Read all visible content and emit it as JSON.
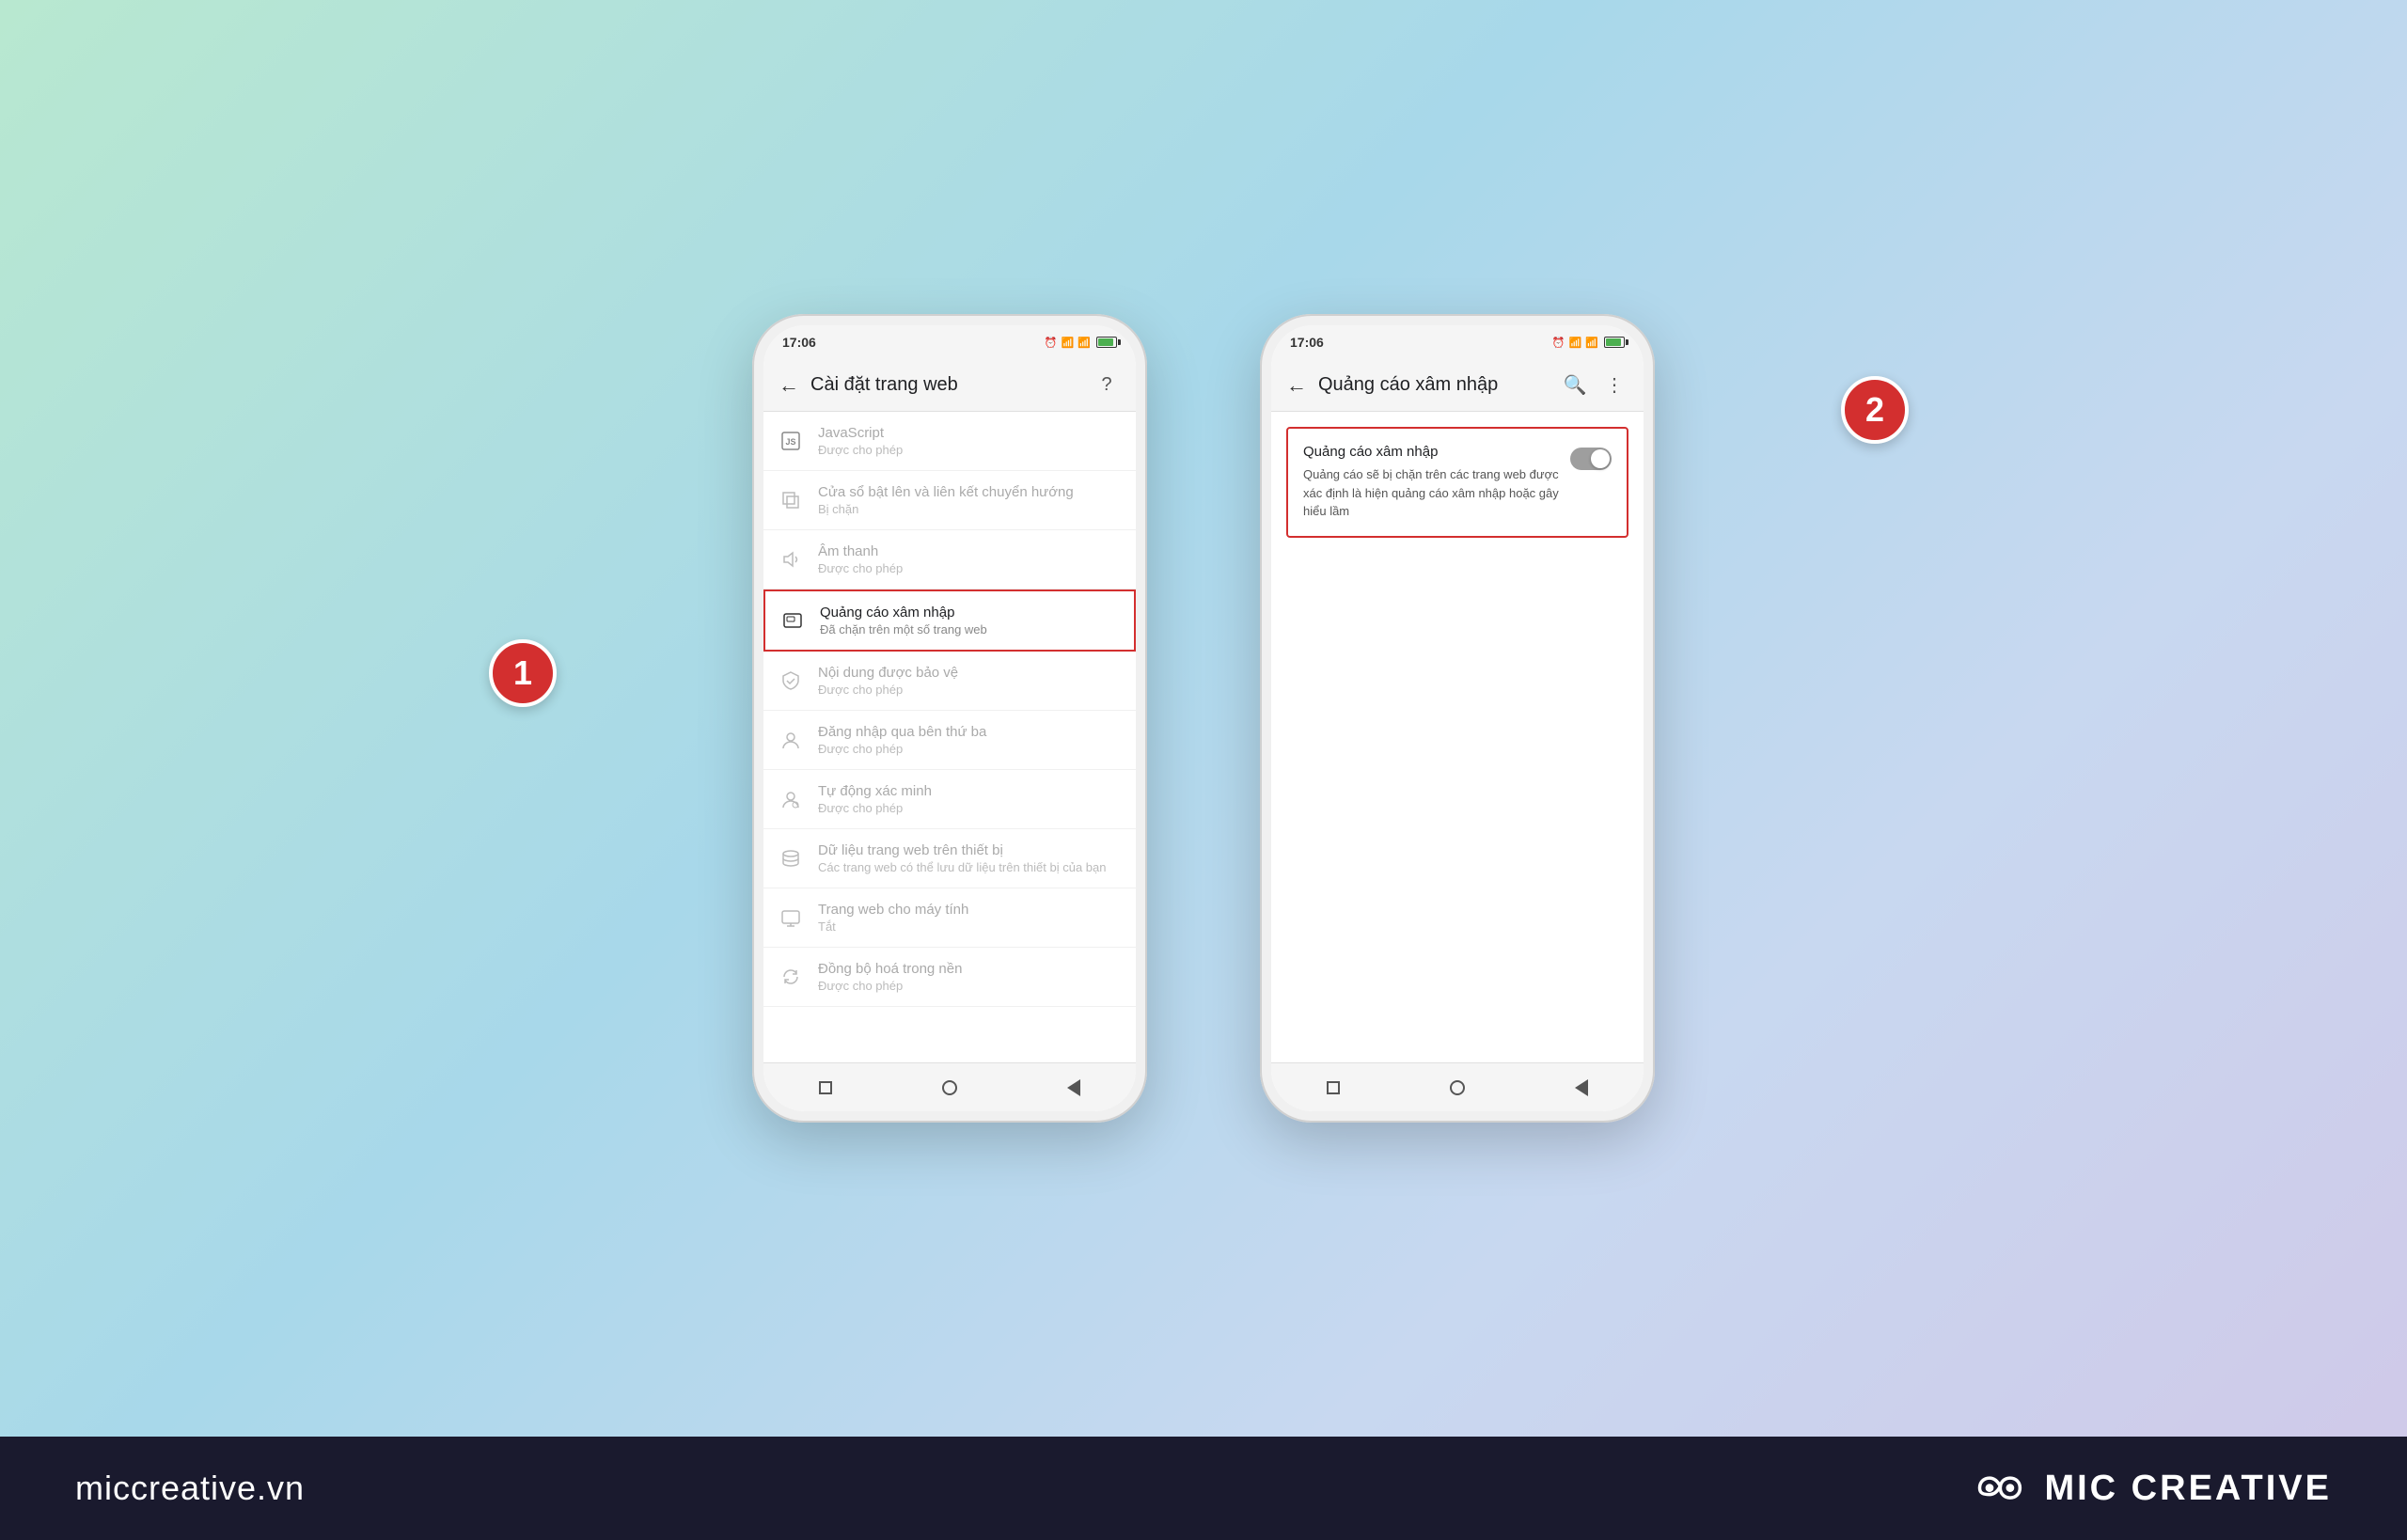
{
  "background": {
    "gradient": "linear-gradient(135deg, #b8e8d0, #a8d8ea, #c8d8f0, #d0c8e8)"
  },
  "bottom_bar": {
    "website": "miccreative.vn",
    "brand": "MIC CREATIVE"
  },
  "step1": {
    "number": "1"
  },
  "step2": {
    "number": "2"
  },
  "phone1": {
    "status_time": "17:06",
    "app_bar_title": "Cài đặt trang web",
    "settings_items": [
      {
        "icon": "js",
        "title": "JavaScript",
        "subtitle": "Được cho phép",
        "muted": true
      },
      {
        "icon": "link",
        "title": "Cửa sổ bật lên và liên kết chuyển hướng",
        "subtitle": "Bị chặn",
        "muted": true
      },
      {
        "icon": "sound",
        "title": "Âm thanh",
        "subtitle": "Được cho phép",
        "muted": true
      },
      {
        "icon": "ads",
        "title": "Quảng cáo xâm nhập",
        "subtitle": "Đã chặn trên một số trang web",
        "muted": false,
        "highlighted": true
      },
      {
        "icon": "protect",
        "title": "Nội dung được bảo vệ",
        "subtitle": "Được cho phép",
        "muted": true
      },
      {
        "icon": "login",
        "title": "Đăng nhập qua bên thứ ba",
        "subtitle": "Được cho phép",
        "muted": true
      },
      {
        "icon": "verify",
        "title": "Tự động xác minh",
        "subtitle": "Được cho phép",
        "muted": true
      },
      {
        "icon": "data",
        "title": "Dữ liệu trang web trên thiết bị",
        "subtitle": "Các trang web có thể lưu dữ liệu trên thiết bị của bạn",
        "muted": true
      },
      {
        "icon": "desktop",
        "title": "Trang web cho máy tính",
        "subtitle": "Tắt",
        "muted": true
      },
      {
        "icon": "sync",
        "title": "Đồng bộ hoá trong nền",
        "subtitle": "Được cho phép",
        "muted": true
      }
    ]
  },
  "phone2": {
    "status_time": "17:06",
    "app_bar_title": "Quảng cáo xâm nhập",
    "toggle_title": "Quảng cáo xâm nhập",
    "toggle_desc": "Quảng cáo sẽ bị chặn trên các trang web được xác định là hiện quảng cáo xâm nhập hoặc gây hiểu lầm",
    "toggle_state": "off"
  }
}
